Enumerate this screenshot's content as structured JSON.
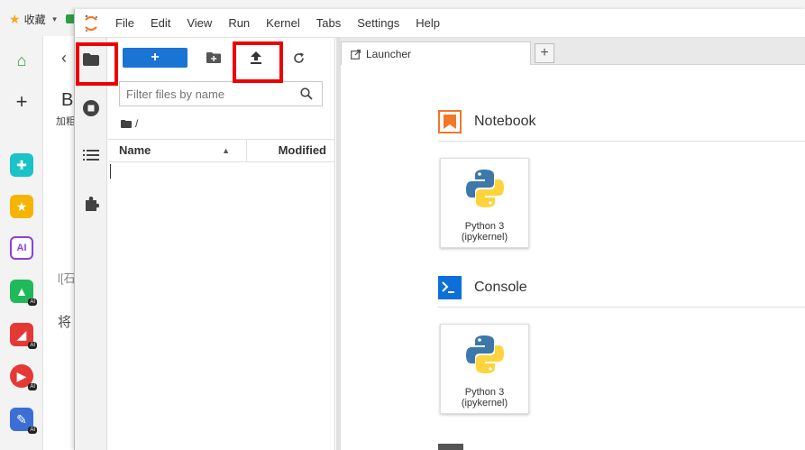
{
  "browser": {
    "bookmarks_label": "收藏",
    "behind_text": [
      "B",
      "加粗",
      "l[石",
      "将"
    ]
  },
  "menubar": {
    "items": [
      "File",
      "Edit",
      "View",
      "Run",
      "Kernel",
      "Tabs",
      "Settings",
      "Help"
    ]
  },
  "filebrowser": {
    "new_label": "+",
    "filter_placeholder": "Filter files by name",
    "breadcrumb": "/",
    "columns": {
      "name": "Name",
      "modified": "Modified"
    }
  },
  "tabs": {
    "launcher_label": "Launcher",
    "add_label": "+"
  },
  "launcher": {
    "notebook_title": "Notebook",
    "console_title": "Console",
    "notebook_kernel": {
      "line1": "Python 3",
      "line2": "(ipykernel)"
    },
    "console_kernel": {
      "line1": "Python 3",
      "line2": "(ipykernel)"
    }
  },
  "colors": {
    "accent": "#1a74d4",
    "highlight": "#ee0000",
    "notebook_icon": "#f37726",
    "console_icon": "#0d6fd9"
  }
}
